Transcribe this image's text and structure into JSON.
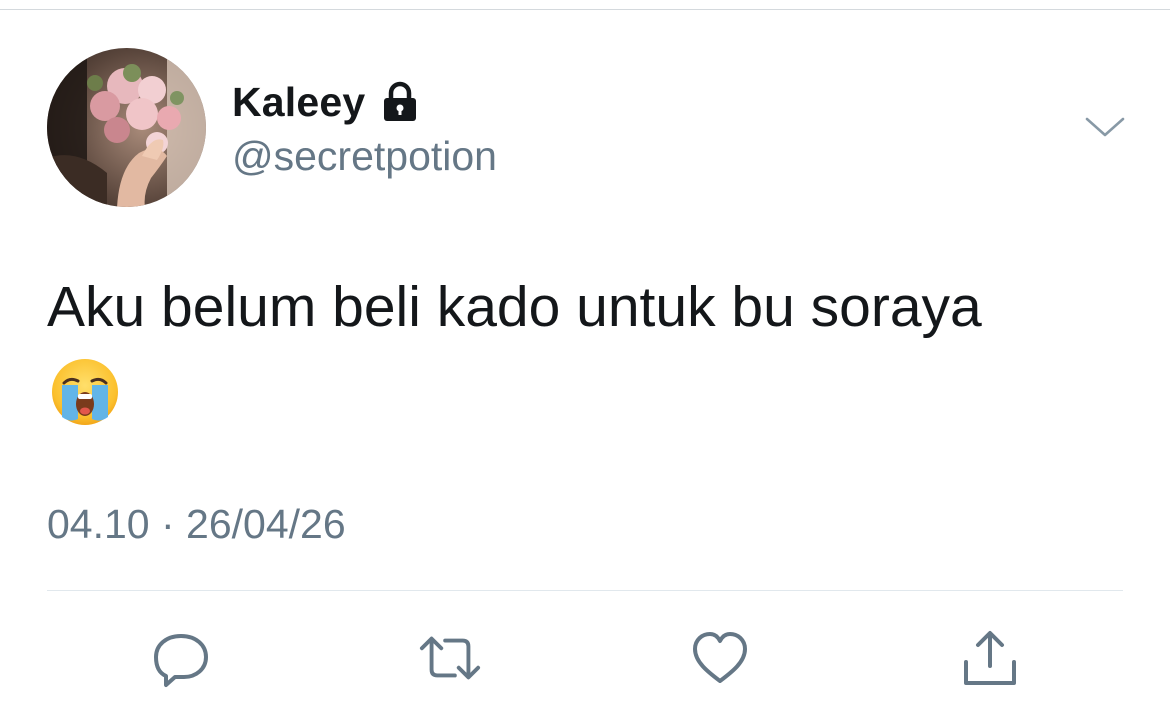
{
  "tweet": {
    "display_name": "Kaleey",
    "handle": "@secretpotion",
    "text": "Aku belum beli kado untuk bu soraya",
    "emoji": "loudly-crying-face",
    "timestamp": "04.10 · 26/04/26"
  },
  "icons": {
    "lock": "lock-icon",
    "menu": "chevron-down-icon",
    "reply": "reply-icon",
    "retweet": "retweet-icon",
    "like": "heart-icon",
    "share": "share-icon"
  },
  "colors": {
    "text_primary": "#14171a",
    "text_secondary": "#657786",
    "icon_gray": "#657786",
    "divider": "#e1e8ed"
  }
}
